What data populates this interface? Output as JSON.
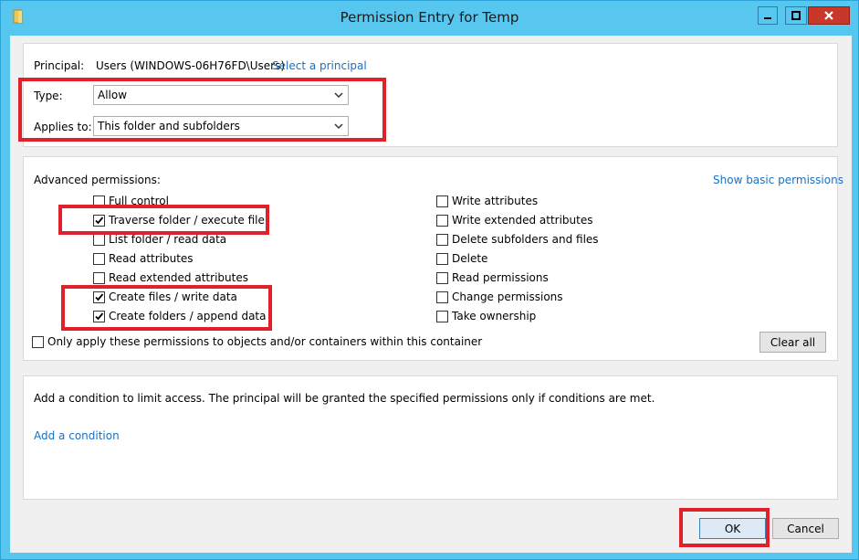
{
  "window": {
    "title": "Permission Entry for Temp",
    "icon": "folder-icon"
  },
  "principal": {
    "label": "Principal:",
    "value": "Users (WINDOWS-06H76FD\\Users)",
    "link": "Select a principal"
  },
  "type": {
    "label": "Type:",
    "value": "Allow"
  },
  "applies_to": {
    "label": "Applies to:",
    "value": "This folder and subfolders"
  },
  "advanced": {
    "title": "Advanced permissions:",
    "show_basic_link": "Show basic permissions",
    "left_permissions": [
      {
        "label": "Full control",
        "checked": false
      },
      {
        "label": "Traverse folder / execute file",
        "checked": true
      },
      {
        "label": "List folder / read data",
        "checked": false
      },
      {
        "label": "Read attributes",
        "checked": false
      },
      {
        "label": "Read extended attributes",
        "checked": false
      },
      {
        "label": "Create files / write data",
        "checked": true
      },
      {
        "label": "Create folders / append data",
        "checked": true
      }
    ],
    "right_permissions": [
      {
        "label": "Write attributes",
        "checked": false
      },
      {
        "label": "Write extended attributes",
        "checked": false
      },
      {
        "label": "Delete subfolders and files",
        "checked": false
      },
      {
        "label": "Delete",
        "checked": false
      },
      {
        "label": "Read permissions",
        "checked": false
      },
      {
        "label": "Change permissions",
        "checked": false
      },
      {
        "label": "Take ownership",
        "checked": false
      }
    ],
    "only_apply": {
      "label": "Only apply these permissions to objects and/or containers within this container",
      "checked": false
    },
    "clear_all": "Clear all"
  },
  "condition": {
    "text": "Add a condition to limit access. The principal will be granted the specified permissions only if conditions are met.",
    "link": "Add a condition"
  },
  "footer": {
    "ok": "OK",
    "cancel": "Cancel"
  },
  "colors": {
    "highlight": "#e0202a",
    "link": "#1a6fc2",
    "titlebar": "#57c7ef"
  }
}
